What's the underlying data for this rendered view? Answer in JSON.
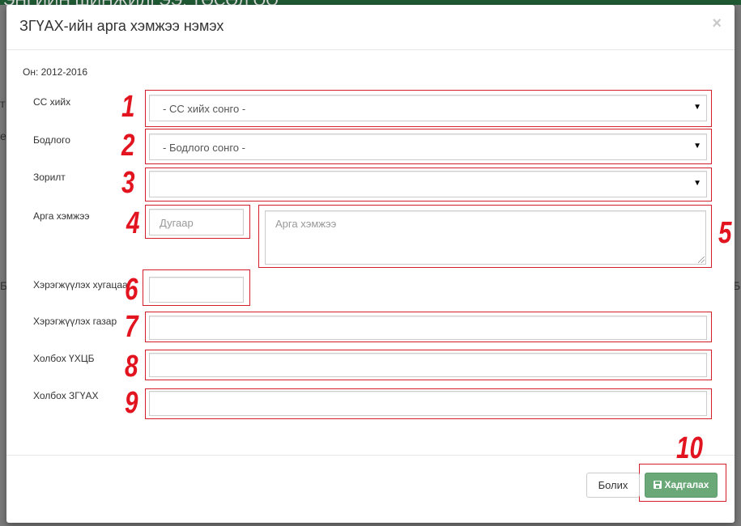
{
  "background": {
    "header_text": "ЭНГИЙН ШИНЖИЛГЭЭ, ТӨСӨЛ ОО",
    "fragments": [
      "т",
      "е",
      "Б",
      "Б"
    ]
  },
  "modal": {
    "title": "ЗГҮАХ-ийн арга хэмжээ нэмэх",
    "close": "×",
    "year": "Он: 2012-2016"
  },
  "form": {
    "ss_label": "СС хийх",
    "ss_value": "- СС хийх сонго -",
    "policy_label": "Бодлого",
    "policy_value": "- Бодлого сонго -",
    "goal_label": "Зорилт",
    "goal_value": "",
    "action_label": "Арга хэмжээ",
    "number_placeholder": "Дугаар",
    "action_placeholder": "Арга хэмжээ",
    "duration_label": "Хэрэгжүүлэх хугацаа",
    "place_label": "Хэрэгжүүлэх газар",
    "link_uhcb_label": "Холбох ҮХЦБ",
    "link_zguah_label": "Холбох ЗГҮАХ"
  },
  "footer": {
    "cancel_label": "Болих",
    "save_label": "Хадгалах"
  },
  "annotations": [
    "1",
    "2",
    "3",
    "4",
    "5",
    "6",
    "7",
    "8",
    "9",
    "10"
  ],
  "colors": {
    "highlight": "#d21f2b",
    "annotation_number": "#e2141f",
    "save_button": "#6aa878",
    "header_bar": "#1f5a33"
  },
  "icons": {
    "close": "close-icon",
    "caret": "caret-down-icon",
    "save": "floppy-disk-icon"
  }
}
